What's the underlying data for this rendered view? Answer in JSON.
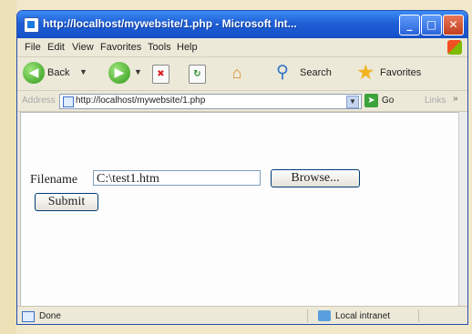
{
  "window": {
    "title": "http://localhost/mywebsite/1.php - Microsoft Int...",
    "buttons": {
      "minimize": "_",
      "maximize": "□",
      "close": "✕"
    }
  },
  "menu": [
    "File",
    "Edit",
    "View",
    "Favorites",
    "Tools",
    "Help"
  ],
  "toolbar": {
    "back": "Back",
    "search": "Search",
    "favorites": "Favorites"
  },
  "address": {
    "label": "Address",
    "url": "http://localhost/mywebsite/1.php",
    "go": "Go",
    "links": "Links"
  },
  "form": {
    "filename_label": "Filename",
    "filename_value": "C:\\test1.htm",
    "browse": "Browse...",
    "submit": "Submit"
  },
  "status": {
    "text": "Done",
    "zone": "Local intranet"
  }
}
